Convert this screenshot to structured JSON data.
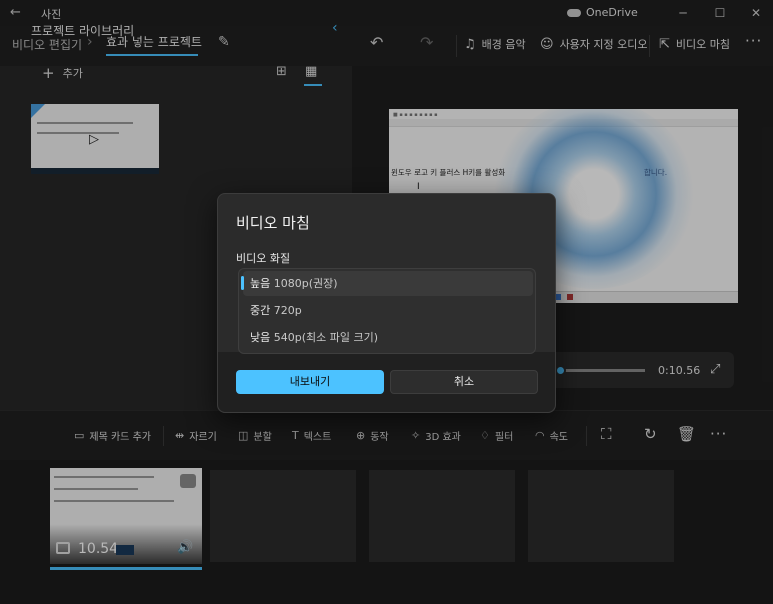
{
  "window": {
    "title": "사진",
    "onedrive": "OneDrive",
    "back_icon": "back-arrow-icon",
    "minimize": "─",
    "maximize": "☐",
    "close": "✕"
  },
  "topnav": {
    "crumb_editor": "비디오 편집기",
    "crumb_project": "효과 넣는 프로젝트",
    "bg_music": "배경 음악",
    "custom_audio": "사용자 지정 오디오",
    "finish_video": "비디오 마침"
  },
  "library": {
    "title": "프로젝트 라이브러리",
    "add": "추가"
  },
  "preview": {
    "screen_line": "윈도우 로고 키 플러스 H키를 활성화",
    "screen_line2": "합니다.",
    "time": "0:10.56"
  },
  "toolbar": {
    "title_card": "제목 카드 추가",
    "trim": "자르기",
    "split": "분할",
    "text": "텍스트",
    "motion": "동작",
    "effects_3d": "3D 효과",
    "filter": "필터",
    "speed": "속도"
  },
  "storyboard": {
    "clip_duration": "10.54"
  },
  "dialog": {
    "title": "비디오 마침",
    "quality_label": "비디오 화질",
    "options": [
      {
        "name": "높음",
        "detail": "1080p(권장)"
      },
      {
        "name": "중간",
        "detail": "720p"
      },
      {
        "name": "낮음",
        "detail": "540p(최소 파일 크기)"
      }
    ],
    "selected_index": 0,
    "export": "내보내기",
    "cancel": "취소"
  },
  "colors": {
    "accent": "#4cc2ff",
    "background": "#1b1b1b",
    "panel": "#272727",
    "dialog": "#2b2b2b"
  }
}
